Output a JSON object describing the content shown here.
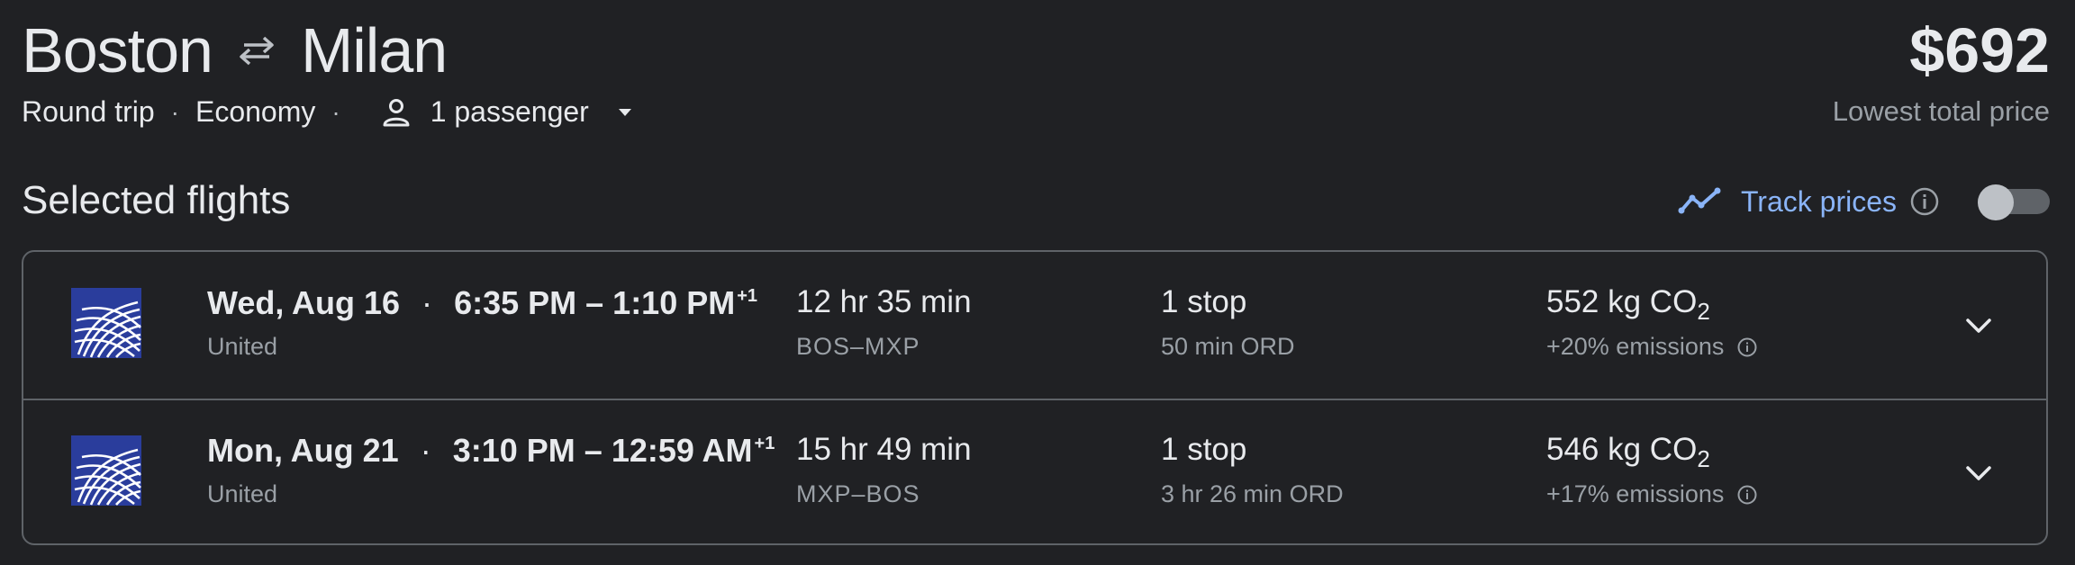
{
  "header": {
    "origin": "Boston",
    "destination": "Milan",
    "trip_type": "Round trip",
    "cabin": "Economy",
    "passengers": "1 passenger",
    "price": "$692",
    "price_label": "Lowest total price"
  },
  "selected": {
    "title": "Selected flights",
    "track_label": "Track prices",
    "track_enabled": false
  },
  "flights": [
    {
      "date": "Wed, Aug 16",
      "depart": "6:35 PM",
      "arrive": "1:10 PM",
      "day_offset": "+1",
      "airline": "United",
      "duration": "12 hr 35 min",
      "route": "BOS–MXP",
      "stops": "1 stop",
      "layover": "50 min ORD",
      "co2_value": "552 kg CO",
      "co2_sub": "2",
      "emissions": "+20% emissions"
    },
    {
      "date": "Mon, Aug 21",
      "depart": "3:10 PM",
      "arrive": "12:59 AM",
      "day_offset": "+1",
      "airline": "United",
      "duration": "15 hr 49 min",
      "route": "MXP–BOS",
      "stops": "1 stop",
      "layover": "3 hr 26 min ORD",
      "co2_value": "546 kg CO",
      "co2_sub": "2",
      "emissions": "+17% emissions"
    }
  ],
  "colors": {
    "background": "#202124",
    "accent": "#8ab4f8",
    "border": "#5f6368",
    "secondary_text": "#9aa0a6",
    "united_blue": "#2a3d9c"
  },
  "icons": {
    "swap": "swap-arrows-icon",
    "passenger": "person-icon",
    "dropdown": "caret-down-icon",
    "track": "trend-line-icon",
    "info": "info-icon",
    "expand": "chevron-down-icon",
    "airline_logo": "united-globe-logo"
  }
}
